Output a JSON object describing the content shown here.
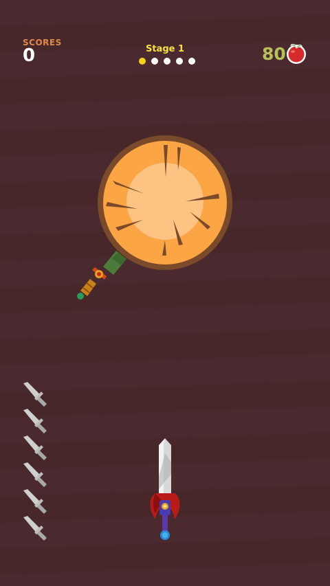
{
  "hud": {
    "scores_label": "SCORES",
    "scores_value": "0",
    "stage_label": "Stage 1",
    "stage_dots_total": 5,
    "stage_dots_active": 1,
    "apple_count": "80"
  },
  "icons": {
    "apple": "apple-icon",
    "knife_remaining": "knife-icon"
  },
  "knives_remaining": 6,
  "colors": {
    "background": "#4a2a2e",
    "score_label": "#e08a4a",
    "stage_label": "#f6e23a",
    "apple_count": "#b5c25a",
    "wood_outer": "#7a4a2a",
    "wood_mid": "#fba545",
    "wood_inner": "#fdc382"
  }
}
